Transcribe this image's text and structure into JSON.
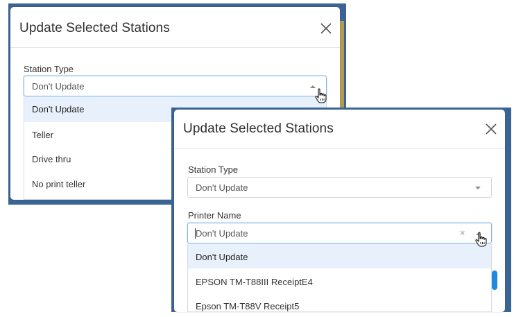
{
  "dialog_back": {
    "title": "Update Selected Stations",
    "station_type_label": "Station Type",
    "station_type_value": "Don't Update",
    "options": [
      "Don't Update",
      "Teller",
      "Drive thru",
      "No print teller"
    ]
  },
  "dialog_front": {
    "title": "Update Selected Stations",
    "station_type_label": "Station Type",
    "station_type_value": "Don't Update",
    "printer_label": "Printer Name",
    "printer_value": "Don't Update",
    "clear_symbol": "×",
    "options": [
      "Don't Update",
      "EPSON TM-T88III ReceiptE4",
      "Epson TM-T88V Receipt5"
    ]
  },
  "icons": {
    "close": "close-icon",
    "dropdown": "chevron-down-icon",
    "dropdown_open": "chevron-up-icon",
    "cursor": "hand-cursor-icon"
  },
  "colors": {
    "frame": "#3a6493",
    "selected_option_bg": "#e8f1fb",
    "focus_border": "#86b7e6",
    "primary_button": "#1e88e5"
  }
}
